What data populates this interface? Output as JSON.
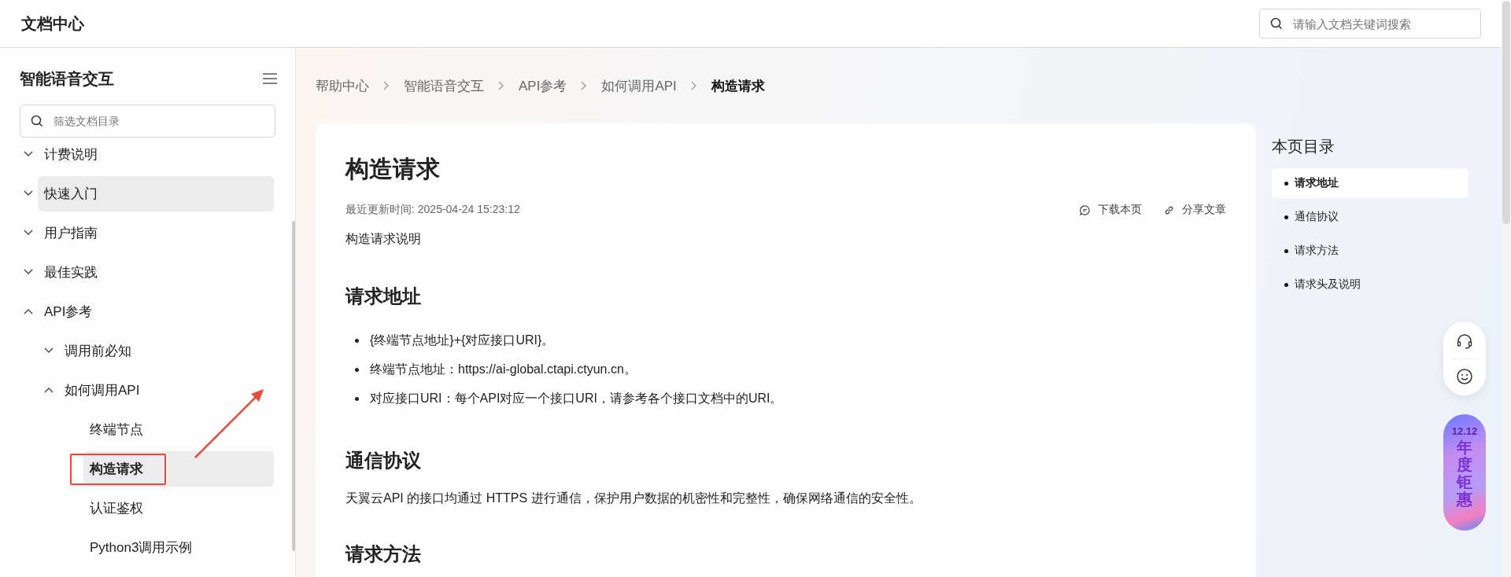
{
  "header": {
    "title": "文档中心",
    "search": {
      "placeholder": "请输入文档关键词搜索"
    }
  },
  "sidebar": {
    "title": "智能语音交互",
    "filter": {
      "placeholder": "筛选文档目录"
    },
    "tree": [
      {
        "label": "计费说明",
        "expanded": false,
        "selected": false,
        "hovered": false
      },
      {
        "label": "快速入门",
        "expanded": false,
        "selected": false,
        "hovered": true
      },
      {
        "label": "用户指南",
        "expanded": false,
        "selected": false,
        "hovered": false
      },
      {
        "label": "最佳实践",
        "expanded": false,
        "selected": false,
        "hovered": false
      },
      {
        "label": "API参考",
        "expanded": true,
        "selected": false,
        "hovered": false,
        "children": [
          {
            "label": "调用前必知",
            "expanded": false,
            "selected": false,
            "hovered": false
          },
          {
            "label": "如何调用API",
            "expanded": true,
            "selected": false,
            "hovered": false,
            "children": [
              {
                "label": "终端节点",
                "selected": false,
                "hovered": false
              },
              {
                "label": "构造请求",
                "selected": true,
                "hovered": false
              },
              {
                "label": "认证鉴权",
                "selected": false,
                "hovered": false
              },
              {
                "label": "Python3调用示例",
                "selected": false,
                "hovered": false
              }
            ]
          }
        ]
      }
    ]
  },
  "breadcrumb": [
    "帮助中心",
    "智能语音交互",
    "API参考",
    "如何调用API",
    "构造请求"
  ],
  "article": {
    "title": "构造请求",
    "updated": "最近更新时间: 2025-04-24 15:23:12",
    "actions": [
      "下载本页",
      "分享文章"
    ],
    "intro": "构造请求说明",
    "sections": [
      {
        "heading": "请求地址",
        "bullets": [
          "{终端节点地址}+{对应接口URI}。",
          "终端节点地址：https://ai-global.ctapi.ctyun.cn。",
          "对应接口URI：每个API对应一个接口URI，请参考各个接口文档中的URI。"
        ]
      },
      {
        "heading": "通信协议",
        "paragraph": "天翼云API 的接口均通过 HTTPS 进行通信，保护用户数据的机密性和完整性，确保网络通信的安全性。"
      },
      {
        "heading": "请求方法"
      }
    ]
  },
  "toc": {
    "title": "本页目录",
    "items": [
      {
        "label": "请求地址",
        "selected": true
      },
      {
        "label": "通信协议",
        "selected": false
      },
      {
        "label": "请求方法",
        "selected": false
      },
      {
        "label": "请求头及说明",
        "selected": false
      }
    ]
  },
  "promo": {
    "date": "12.12",
    "text": "年度钜惠"
  }
}
